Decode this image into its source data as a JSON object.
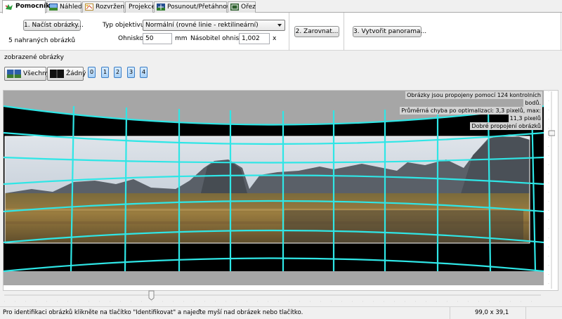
{
  "tabs": [
    {
      "label": "Pomocník",
      "icon": "assistant-icon",
      "active": true
    },
    {
      "label": "Náhled",
      "icon": "preview-icon"
    },
    {
      "label": "Rozvržení",
      "icon": "layout-icon"
    },
    {
      "label": "Projekce",
      "icon": ""
    },
    {
      "label": "Posunout/Přetáhnout",
      "icon": "move-icon"
    },
    {
      "label": "Ořez",
      "icon": "crop-icon"
    }
  ],
  "assistant": {
    "load_button": "1. Načíst obrázky...",
    "loaded_count": "5 nahraných obrázků",
    "lens_type_label": "Typ objektivu:",
    "lens_type_value": "Normální (rovné linie - rektilineární)",
    "focal_label": "Ohnisko:",
    "focal_value": "50",
    "focal_unit": "mm",
    "multiplier_label": "Násobitel ohniska:",
    "multiplier_value": "1,002",
    "multiplier_unit": "x",
    "align_button": "2. Zarovnat...",
    "create_button": "3. Vytvořit panorama..."
  },
  "displayed": {
    "title": "zobrazené obrázky",
    "all_label": "Všechny",
    "none_label": "Žádný",
    "numbers": [
      "0",
      "1",
      "2",
      "3",
      "4"
    ]
  },
  "info_lines": [
    "Obrázky jsou propojeny pomocí 124 kontrolních",
    "bodů.",
    "Průměrná chyba po optimalizaci: 3,3 pixelů, max:",
    "11,3 pixelů",
    "Dobré propojení obrázků"
  ],
  "status": {
    "message": "Pro identifikaci obrázků klikněte na tlačítko \"Identifikovat\" a najeďte myší nad obrázek nebo tlačítko.",
    "coords": "99,0 x 39,1"
  },
  "colors": {
    "grid": "#2fe6e6",
    "canvas_gray": "#a6a6a6",
    "black": "#000000"
  }
}
